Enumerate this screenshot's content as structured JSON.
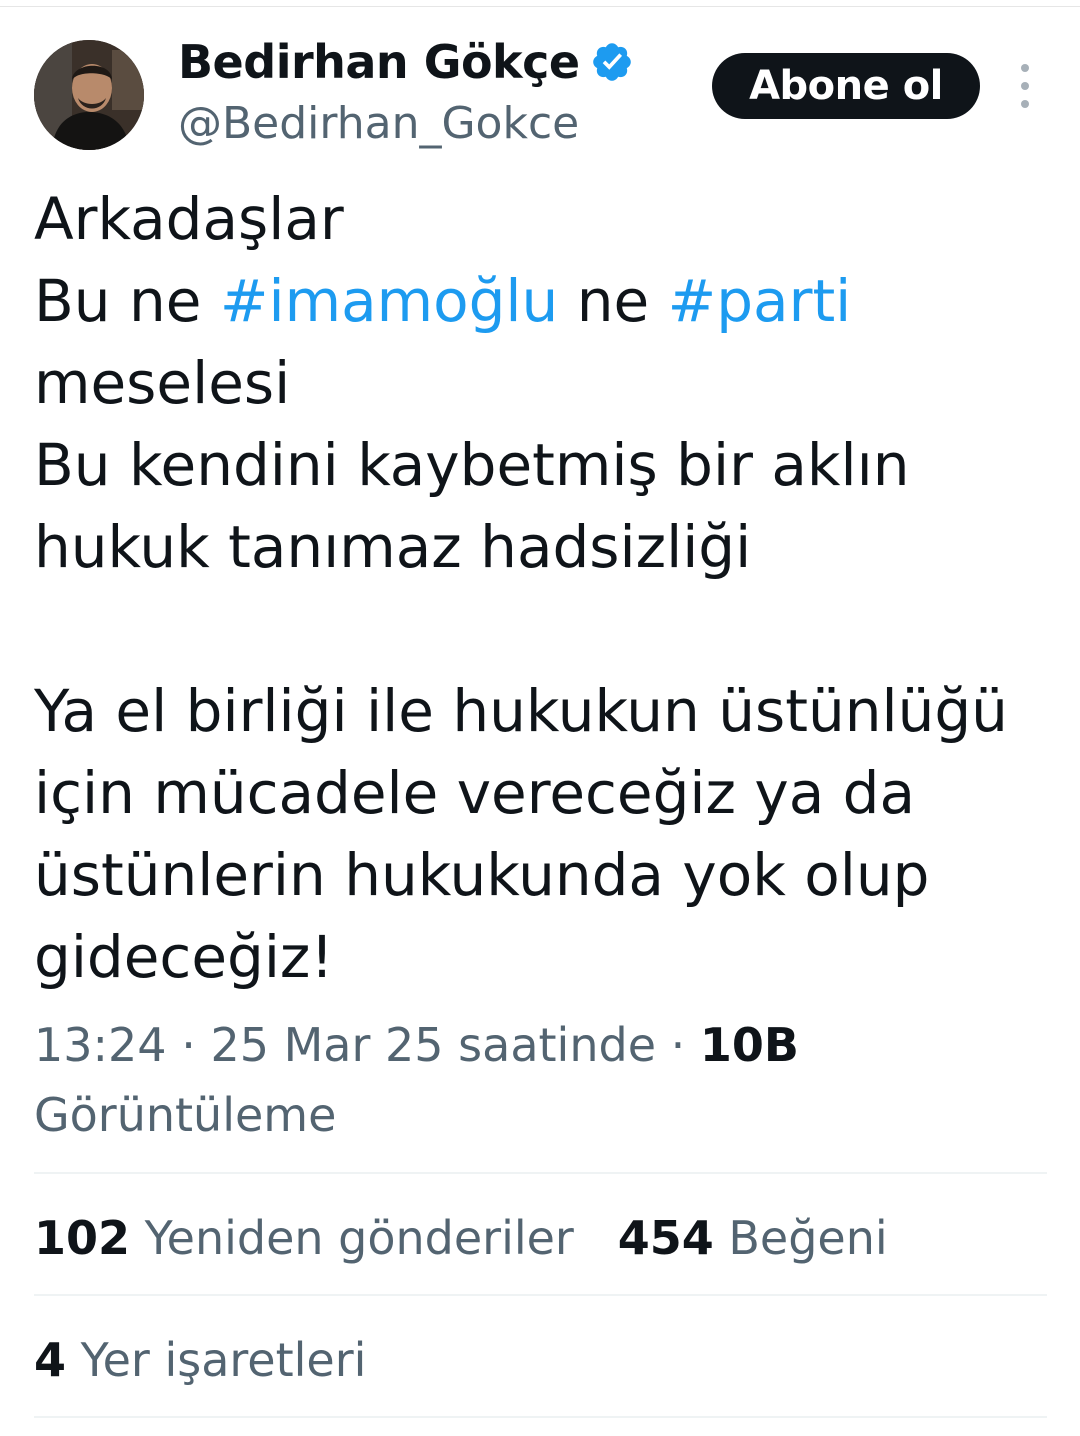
{
  "author": {
    "display_name": "Bedirhan Gökçe",
    "handle": "@Bedirhan_Gokce",
    "verified_icon": "verified-badge-icon",
    "accent": "#1d9bf0"
  },
  "follow_button": {
    "label": "Abone ol"
  },
  "tweet": {
    "line1": "Arkadaşlar",
    "line2_pre": "Bu ne ",
    "hashtag1": "#imamoğlu",
    "line2_mid": " ne ",
    "hashtag2": "#parti",
    "line3": "meselesi",
    "line4": "Bu kendini kaybetmiş bir aklın",
    "line5": "hukuk tanımaz hadsizliği",
    "line6": "Ya el birliği ile hukukun üstünlüğü",
    "line7": "için mücadele vereceğiz ya da",
    "line8": "üstünlerin hukukunda yok olup",
    "line9": "gideceğiz!"
  },
  "meta": {
    "time": "13:24",
    "separator": " · ",
    "date": "25 Mar 25 saatinde",
    "views_count": "10B",
    "views_label": "Görüntüleme"
  },
  "stats": {
    "reposts_count": "102",
    "reposts_label": "Yeniden gönderiler",
    "likes_count": "454",
    "likes_label": "Beğeni",
    "bookmarks_count": "4",
    "bookmarks_label": "Yer işaretleri"
  }
}
